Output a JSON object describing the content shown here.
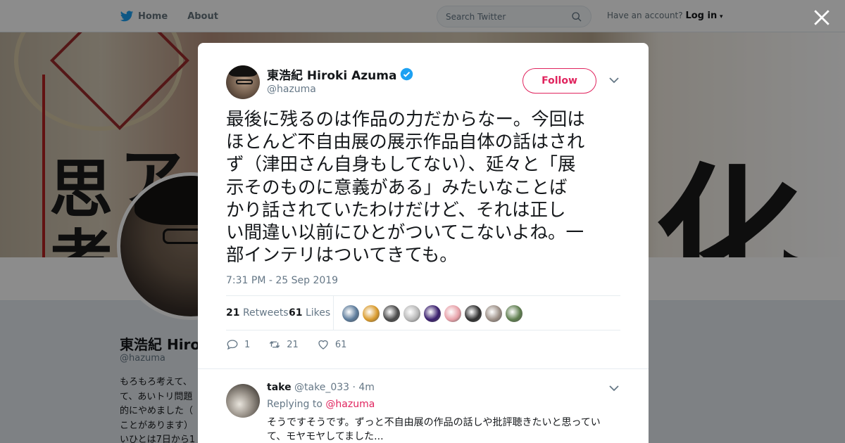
{
  "topbar": {
    "home_label": "Home",
    "about_label": "About",
    "search_placeholder": "Search Twitter",
    "have_account": "Have an account?",
    "login_label": "Log in"
  },
  "profile": {
    "name": "東浩紀 Hiro",
    "handle": "@hazuma",
    "bio": "もろもろ考えて、\nて、あいトリ問題\n的にやめました（\nことがあります）\nいひとは7日から1",
    "banner_text": [
      "思",
      "ア",
      "考",
      "化"
    ]
  },
  "tweet": {
    "author_name": "東浩紀 Hiroki Azuma",
    "author_handle": "@hazuma",
    "follow_label": "Follow",
    "text": "最後に残るのは作品の力だからなー。今回は\nほとんど不自由展の展示作品自体の話はされ\nず（津田さん自身もしてない）、延々と「展\n示そのものに意義がある」みたいなことば\nかり話されていたわけだけど、それは正し\nい間違い以前にひとがついてこないよね。一\n部インテリはついてきても。",
    "timestamp": "7:31 PM - 25 Sep 2019",
    "retweets_count": "21",
    "retweets_label": "Retweets",
    "likes_count": "61",
    "likes_label": "Likes",
    "liker_colors": [
      "#5b7a9a",
      "#d99a2b",
      "#4a4a4a",
      "#b8b8b8",
      "#3a1f6e",
      "#e7a0a8",
      "#2f2f2f",
      "#9c8f86",
      "#5e7d4e"
    ],
    "reply_count": "1",
    "retweet_action_count": "21",
    "like_action_count": "61"
  },
  "reply": {
    "name": "take",
    "handle": "@take_033",
    "time": "· 4m",
    "replying_to_label": "Replying to",
    "replying_to_handle": "@hazuma",
    "text": "そうですそうです。ずっと不自由展の作品の話しや批評聴きたいと思ってい\nて、モヤモヤしてました..."
  },
  "colors": {
    "accent": "#e0245e",
    "twitter_blue": "#1da1f2",
    "secondary_text": "#657786"
  }
}
